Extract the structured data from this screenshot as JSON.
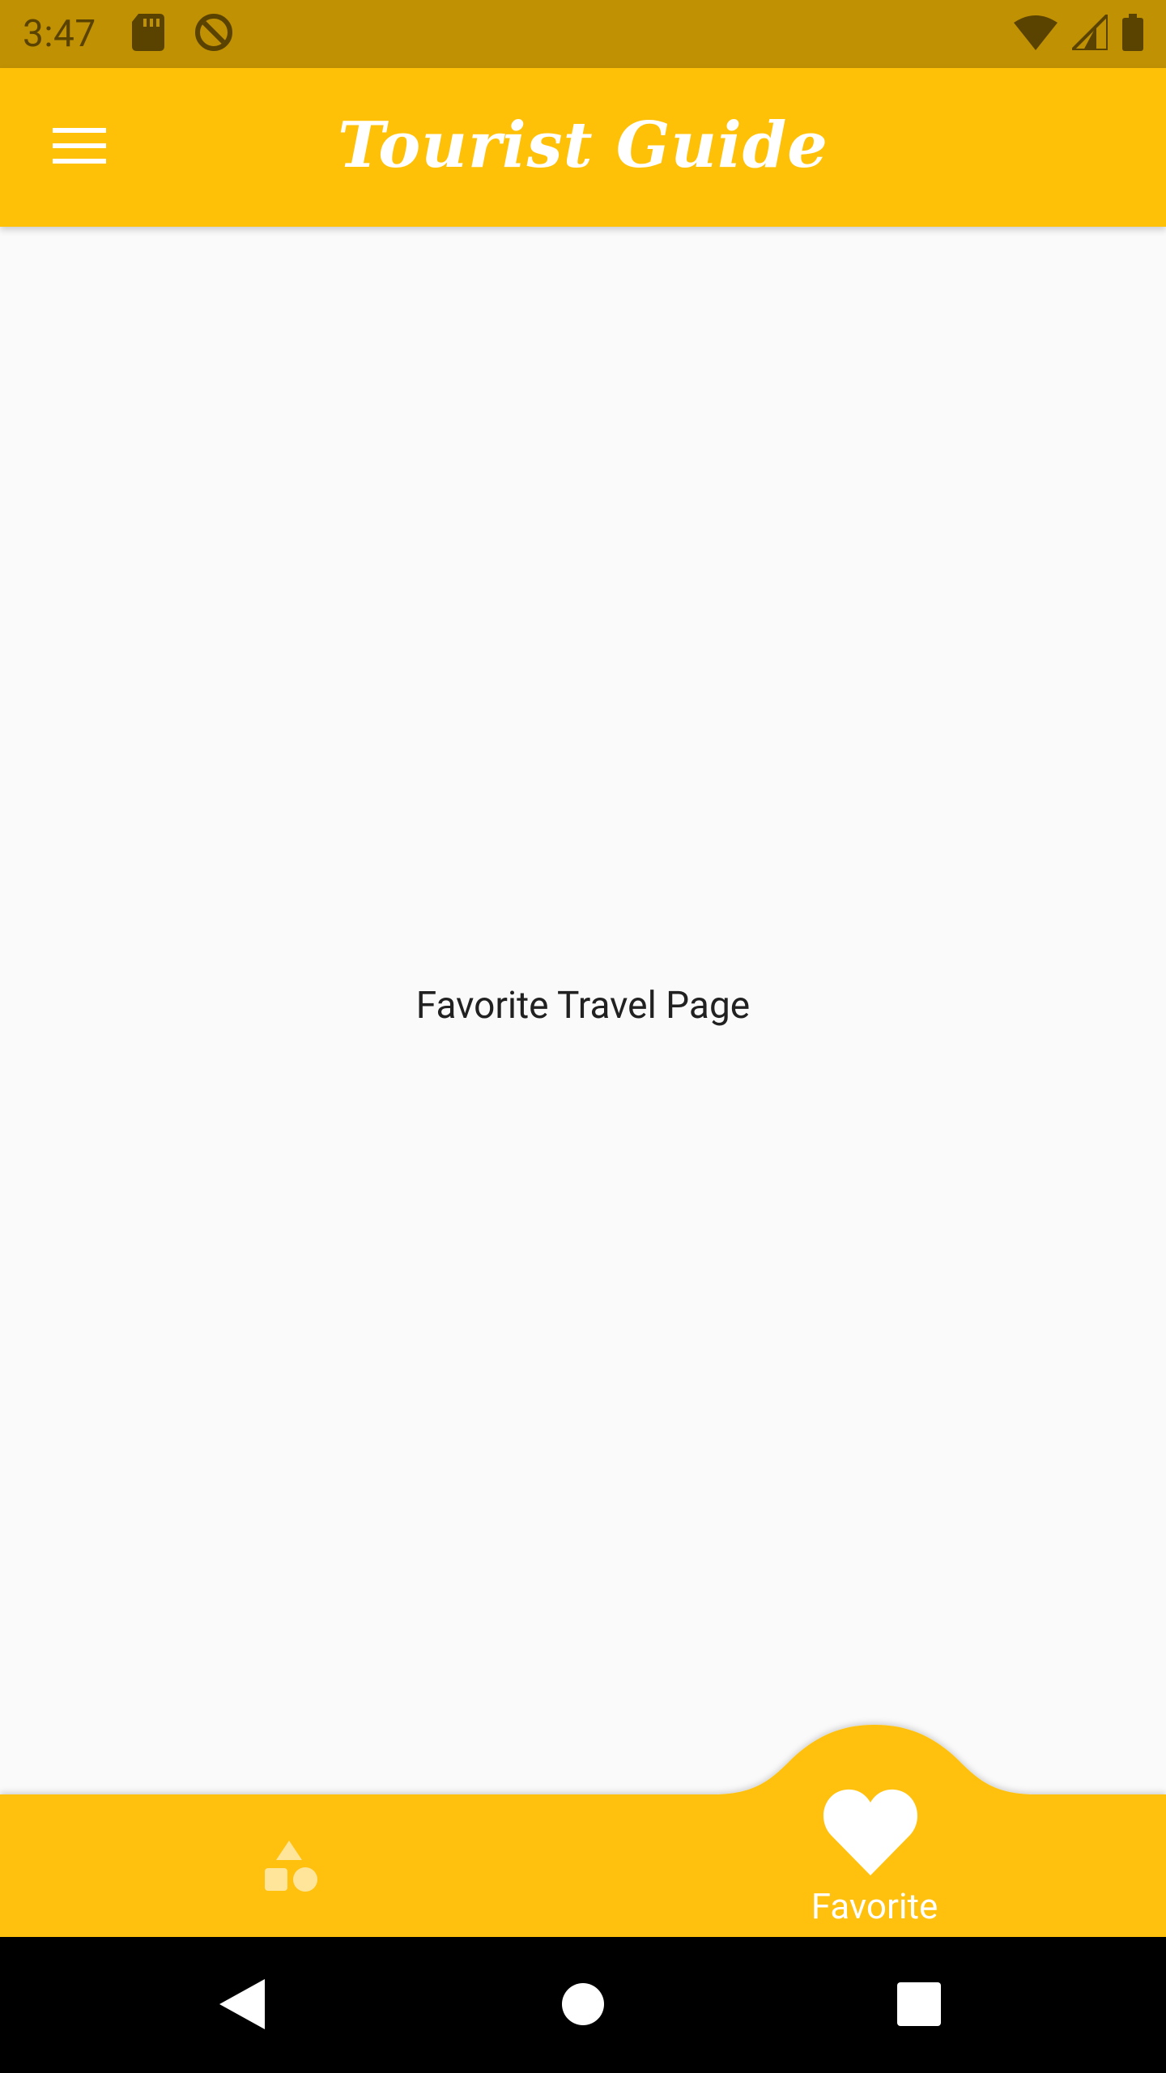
{
  "status_bar": {
    "time": "3:47",
    "icons_left": [
      "sd-card-icon",
      "do-not-disturb-icon"
    ],
    "icons_right": [
      "wifi-icon",
      "cell-signal-icon",
      "battery-icon"
    ]
  },
  "app_bar": {
    "title": "Tourist Guide",
    "menu_icon": "hamburger-menu-icon"
  },
  "main": {
    "page_label": "Favorite Travel Page"
  },
  "bottom_nav": {
    "items": [
      {
        "icon": "category-shapes-icon",
        "label": "",
        "selected": false
      },
      {
        "icon": "heart-icon",
        "label": "Favorite",
        "selected": true
      }
    ]
  },
  "system_nav": {
    "buttons": [
      "back-icon",
      "home-icon",
      "recents-icon"
    ]
  },
  "colors": {
    "primary": "#ffc107",
    "status_bar": "#c19104",
    "background": "#fafafa"
  }
}
